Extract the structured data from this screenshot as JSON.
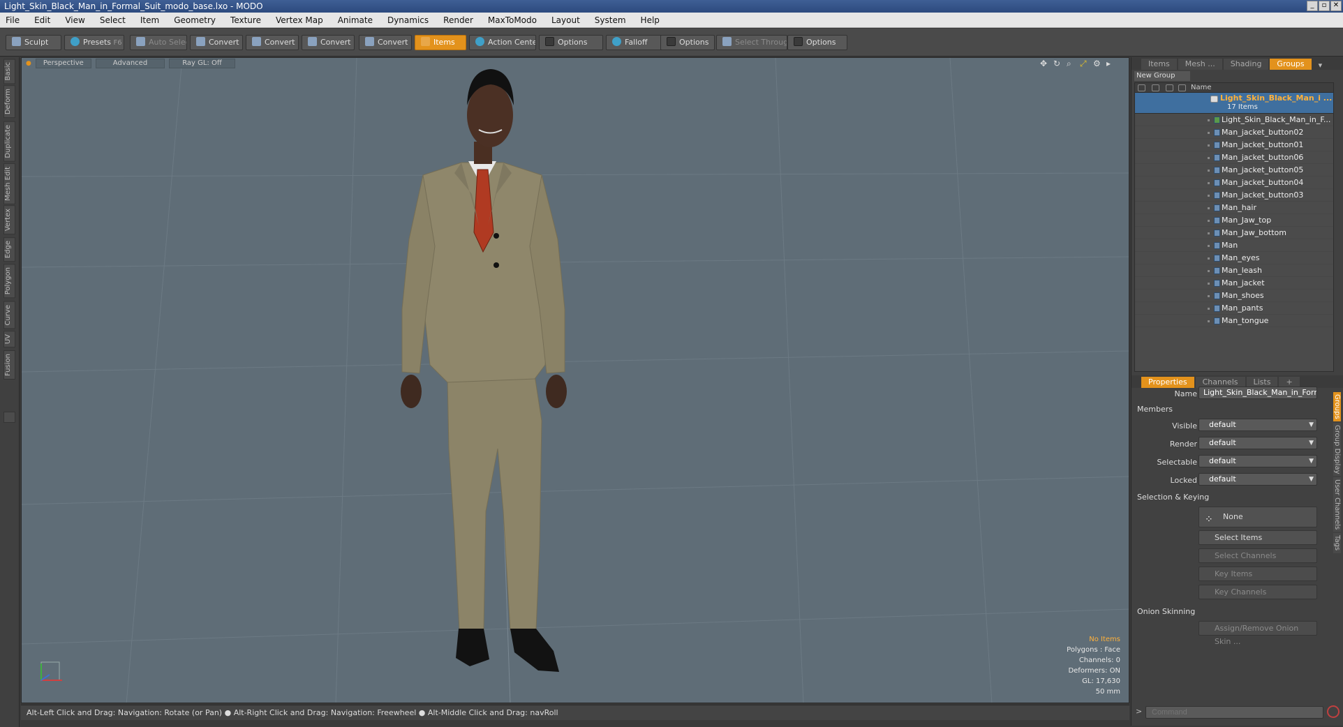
{
  "window": {
    "title": "Light_Skin_Black_Man_in_Formal_Suit_modo_base.lxo - MODO"
  },
  "menu": [
    "File",
    "Edit",
    "View",
    "Select",
    "Item",
    "Geometry",
    "Texture",
    "Vertex Map",
    "Animate",
    "Dynamics",
    "Render",
    "MaxToModo",
    "Layout",
    "System",
    "Help"
  ],
  "toolbar": {
    "sculpt": "Sculpt",
    "presets": "Presets",
    "presets_key": "F6",
    "auto_select": "Auto Select",
    "convert1": "Convert",
    "convert2": "Convert",
    "convert3": "Convert",
    "convert4": "Convert",
    "items": "Items",
    "action_center": "Action Center",
    "options1": "Options",
    "falloff": "Falloff",
    "options2": "Options",
    "select_through": "Select Through",
    "options3": "Options"
  },
  "left_tabs": [
    "Basic",
    "Deform",
    "Duplicate",
    "Mesh Edit",
    "Vertex",
    "Edge",
    "Polygon",
    "Curve",
    "UV",
    "Fusion"
  ],
  "viewport": {
    "view": "Perspective",
    "shading": "Advanced",
    "raygl": "Ray GL: Off",
    "info": {
      "items": "No Items",
      "polygons": "Polygons : Face",
      "channels": "Channels: 0",
      "deformers": "Deformers: ON",
      "gl": "GL: 17,630",
      "focal": "50 mm"
    }
  },
  "status": {
    "hint": "Alt-Left Click and Drag: Navigation: Rotate (or Pan) ● Alt-Right Click and Drag: Navigation: Freewheel ● Alt-Middle Click and Drag: navRoll"
  },
  "right_panel": {
    "tabs": [
      "Items",
      "Mesh ...",
      "Shading",
      "Groups"
    ],
    "active_tab": "Groups",
    "new_group": "New Group",
    "name_col": "Name",
    "group": {
      "name": "Light_Skin_Black_Man_i ...",
      "count": "17 Items"
    },
    "items": [
      "Light_Skin_Black_Man_in_F...",
      "Man_jacket_button02",
      "Man_jacket_button01",
      "Man_jacket_button06",
      "Man_jacket_button05",
      "Man_jacket_button04",
      "Man_jacket_button03",
      "Man_hair",
      "Man_Jaw_top",
      "Man_Jaw_bottom",
      "Man",
      "Man_eyes",
      "Man_leash",
      "Man_jacket",
      "Man_shoes",
      "Man_pants",
      "Man_tongue"
    ],
    "prop_tabs": [
      "Properties",
      "Channels",
      "Lists",
      "+"
    ],
    "props": {
      "name_label": "Name",
      "name_value": "Light_Skin_Black_Man_in_Formal",
      "members": "Members",
      "visible_label": "Visible",
      "visible": "default",
      "render_label": "Render",
      "render": "default",
      "selectable_label": "Selectable",
      "selectable": "default",
      "locked_label": "Locked",
      "locked": "default",
      "sel_keying": "Selection & Keying",
      "none": "None",
      "select_items": "Select Items",
      "select_channels": "Select Channels",
      "key_items": "Key Items",
      "key_channels": "Key Channels",
      "onion": "Onion Skinning",
      "assign_onion": "Assign/Remove Onion Skin ..."
    },
    "side_tabs": [
      "Groups",
      "Group Display",
      "User Channels",
      "Tags"
    ],
    "command_placeholder": "Command"
  }
}
